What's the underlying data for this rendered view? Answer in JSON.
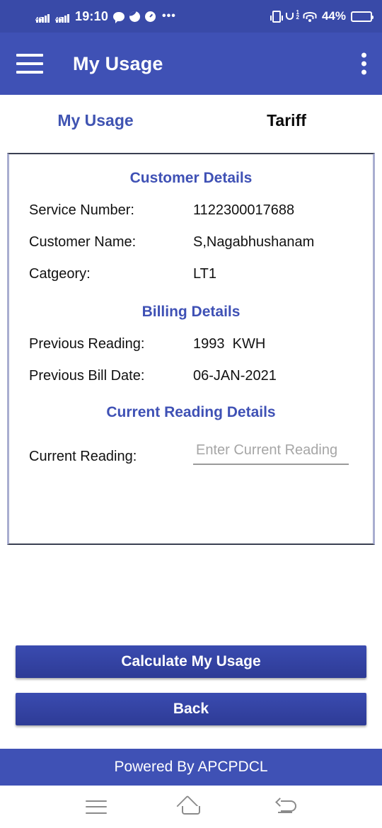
{
  "status_bar": {
    "network_label": "4G",
    "time": "19:10",
    "overflow": "•••",
    "battery_percent": "44%",
    "sim_badge": "1\n2",
    "icons": [
      "signal-4g-icon",
      "signal-4g-icon",
      "chat-bubble-icon",
      "droplet-icon",
      "timer-icon",
      "more-icon",
      "vibrate-icon",
      "call-dual-sim-icon",
      "wifi-icon",
      "battery-icon"
    ]
  },
  "appbar": {
    "title": "My Usage",
    "menu_icon": "hamburger-menu-icon",
    "overflow_icon": "kebab-menu-icon"
  },
  "tabs": [
    {
      "label": "My Usage",
      "active": true
    },
    {
      "label": "Tariff",
      "active": false
    }
  ],
  "card": {
    "customer_details": {
      "heading": "Customer Details",
      "rows": [
        {
          "label": "Service Number:",
          "value": "1122300017688"
        },
        {
          "label": "Customer Name:",
          "value": "S,Nagabhushanam"
        },
        {
          "label": "Catgeory:",
          "value": "LT1"
        }
      ]
    },
    "billing_details": {
      "heading": "Billing Details",
      "rows": [
        {
          "label": "Previous Reading:",
          "value": "1993  KWH"
        },
        {
          "label": "Previous Bill Date:",
          "value": "06-JAN-2021"
        }
      ]
    },
    "current_reading_details": {
      "heading": "Current Reading Details",
      "label": "Current Reading:",
      "input_value": "",
      "input_placeholder": "Enter Current Reading"
    }
  },
  "actions": {
    "calculate_label": "Calculate My Usage",
    "back_label": "Back"
  },
  "footer": {
    "text": "Powered By APCPDCL"
  },
  "navbar": {
    "recents": "recents-icon",
    "home": "home-icon",
    "back": "back-icon"
  },
  "colors": {
    "appbar_blue": "#3f51b5",
    "statusbar_blue": "#394aa8",
    "accent_indigo": "#4054b2",
    "button_blue": "#2e3b96",
    "placeholder_gray": "#a6a6a6"
  }
}
